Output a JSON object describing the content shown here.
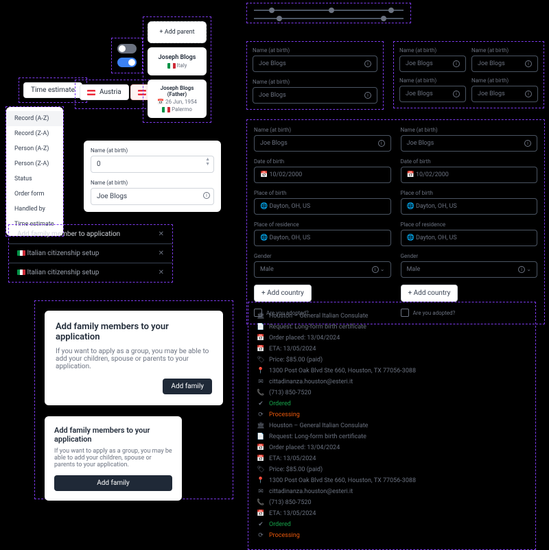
{
  "chips": {
    "timeEstimate": "Time estimate",
    "austria": "Austria"
  },
  "sortMenu": [
    "Record (A-Z)",
    "Record (Z-A)",
    "Person (A-Z)",
    "Person (Z-A)",
    "Status",
    "Order form",
    "Handled by",
    "Time estimate"
  ],
  "parentSection": {
    "addParent": "+  Add parent",
    "personName": "Joseph Blogs",
    "personCountry": "Italy",
    "detailsName": "Joseph Blogs (Father)",
    "detailsDob": "26 Jun, 1954",
    "detailsPlace": "Palermo"
  },
  "lightFields": {
    "label": "Name (at birth)",
    "numValue": "0",
    "textValue": "Joe Blogs"
  },
  "modal": {
    "title": "Add family member to application",
    "row1": "Italian citizenship setup",
    "row2": "Italian citizenship setup"
  },
  "promoCards": {
    "title": "Add family members to your application",
    "body": "If you want to apply as a group, you may be able to add your children, spouse or parents to your application.",
    "cta": "Add family"
  },
  "smallFields": {
    "nameLabel": "Name (at birth)",
    "nameValue": "Joe Blogs"
  },
  "form": {
    "nameLabel": "Name (at birth)",
    "nameValue": "Joe Blogs",
    "dobLabel": "Date of birth",
    "dobValue": "10/02/2000",
    "pobLabel": "Place of birth",
    "pobValue": "Dayton, OH, US",
    "porLabel": "Place of residence",
    "porValue": "Dayton, OH, US",
    "genderLabel": "Gender",
    "genderValue": "Male",
    "addCountry": "+  Add country",
    "adopted": "Are you adopted?"
  },
  "orderInfo": {
    "consulate": "Houston – General Italian Consulate",
    "request": "Request: Long-form birth certificate",
    "placed": "Order placed: 13/04/2024",
    "eta": "ETA: 13/05/2024",
    "price": "Price: $85.00 (paid)",
    "address": "1300 Post Oak Blvd Ste 660, Houston, TX 77056-3088",
    "email": "cittadinanza.houston@esteri.it",
    "phone": "(713) 850-7520",
    "status1": "Ordered",
    "status2": "Processing",
    "eta2": "ETA: 13/05/2024"
  }
}
